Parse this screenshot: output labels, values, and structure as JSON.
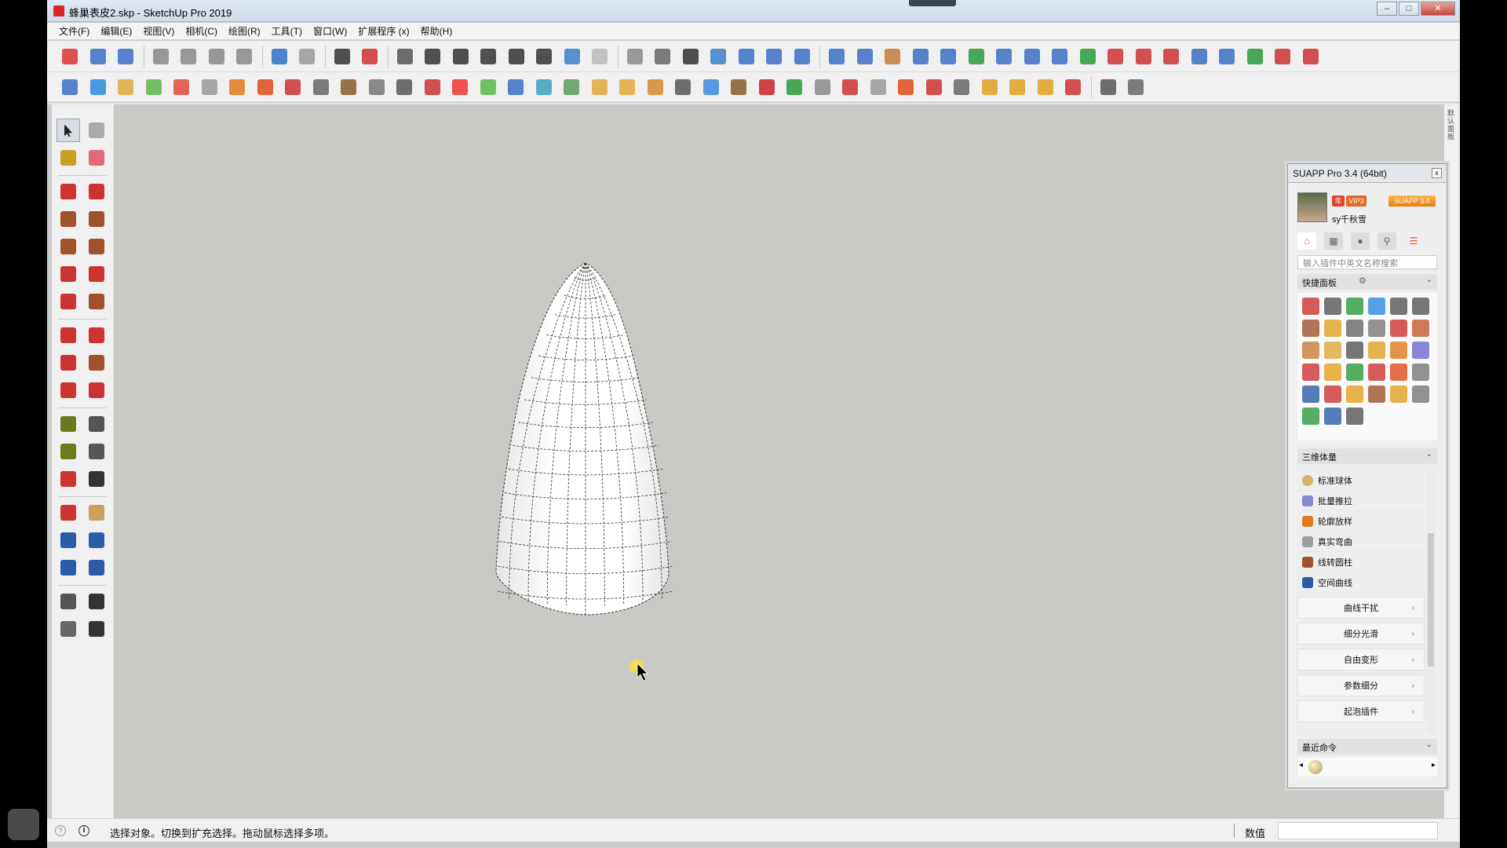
{
  "window": {
    "title": "蜂巢表皮2.skp - SketchUp Pro 2019",
    "controls": {
      "minimize": "–",
      "maximize": "□",
      "close": "✕"
    }
  },
  "menubar": {
    "items": [
      "文件(F)",
      "编辑(E)",
      "视图(V)",
      "相机(C)",
      "绘图(R)",
      "工具(T)",
      "窗口(W)",
      "扩展程序 (x)",
      "帮助(H)"
    ]
  },
  "toolbar1": {
    "icons": [
      "new-file",
      "open-file",
      "save",
      "cut",
      "copy",
      "paste",
      "erase",
      "undo",
      "redo",
      "print",
      "model-info",
      "iso-view",
      "top-view",
      "front-view",
      "right-view",
      "back-view",
      "left-view",
      "xray",
      "wireframe",
      "hidden-line",
      "shaded",
      "shaded-texture",
      "monochrome",
      "section-plane",
      "section-display",
      "section-cut",
      "arc",
      "line",
      "freehand",
      "curve",
      "bezier",
      "arc2",
      "rectangle",
      "circle",
      "arc3",
      "polyline",
      "fillet",
      "round",
      "arc4",
      "spline",
      "polygon",
      "wrench",
      "ellipse",
      "bezier2"
    ],
    "colors": [
      "#d33",
      "#3a6fc4",
      "#3a6fc4",
      "#888",
      "#888",
      "#888",
      "#888",
      "#2f6fc9",
      "#999",
      "#333",
      "#c33",
      "#555",
      "#333",
      "#333",
      "#333",
      "#333",
      "#333",
      "#3a7fc9",
      "#bbb",
      "#888",
      "#666",
      "#333",
      "#3a7fc9",
      "#3a6fc4",
      "#3a6fc4",
      "#3a6fc4",
      "#3a6fc4",
      "#3a6fc4",
      "#c47a3a",
      "#3a6fc4",
      "#3a6fc4",
      "#2a9a3a",
      "#3a6fc4",
      "#3a6fc4",
      "#3a6fc4",
      "#2a9a3a",
      "#c33",
      "#c33",
      "#c33",
      "#3a6fc4",
      "#3a6fc4",
      "#2a9a3a",
      "#c33",
      "#c33"
    ]
  },
  "toolbar2": {
    "icons": [
      "layer1",
      "layer2",
      "layer3",
      "layer4",
      "layer5",
      "layer6",
      "rotate-copy",
      "face-red",
      "grid-lines",
      "frame",
      "box",
      "bridge",
      "corner",
      "dots-curve",
      "cross-red",
      "cross-green",
      "cross-blue",
      "cone",
      "cone2",
      "pyramid",
      "hook",
      "hook2",
      "rotate",
      "move-blue",
      "cube-brown",
      "undo-red",
      "green-shape",
      "move-multi",
      "move-multi2",
      "move-multi3",
      "red-square",
      "shapes",
      "frame-grid",
      "grid-orange",
      "grid-orange2",
      "grid-orange3",
      "x-red",
      "dot-circle",
      "tiles"
    ],
    "colors": [
      "#3a6fc4",
      "#2a8ae0",
      "#e0a83a",
      "#5ab84a",
      "#e04a3a",
      "#999",
      "#e07a1a",
      "#e04a1a",
      "#c33",
      "#666",
      "#8a5a2a",
      "#777",
      "#555",
      "#c33",
      "#e33",
      "#5ab84a",
      "#3a6fc4",
      "#3aa0c4",
      "#5a9a5a",
      "#e0a83a",
      "#e0a83a",
      "#d08a2a",
      "#555",
      "#3a8ae0",
      "#8a5a2a",
      "#c22",
      "#2a9a3a",
      "#888",
      "#c33",
      "#999",
      "#e04a1a",
      "#c33",
      "#666",
      "#e0a020",
      "#e0a020",
      "#e0a020",
      "#c33",
      "#555",
      "#666"
    ]
  },
  "left_toolbar": {
    "tools": [
      [
        "select-tool",
        "component-tool"
      ],
      [
        "paint-bucket-tool",
        "eraser-tool"
      ],
      [
        "line-tool",
        "freehand-tool"
      ],
      [
        "rectangle-tool",
        "rotated-rectangle-tool"
      ],
      [
        "circle-tool",
        "polygon-tool"
      ],
      [
        "arc-tool",
        "two-point-arc-tool"
      ],
      [
        "pie-tool",
        "three-point-arc-tool"
      ],
      [
        "move-tool",
        "push-pull-tool"
      ],
      [
        "rotate-tool",
        "follow-me-tool"
      ],
      [
        "scale-tool",
        "offset-tool"
      ],
      [
        "tape-measure-tool",
        "dimension-tool"
      ],
      [
        "protractor-tool",
        "text-tool"
      ],
      [
        "axes-tool",
        "3d-text-tool"
      ],
      [
        "orbit-tool",
        "pan-tool"
      ],
      [
        "zoom-tool",
        "zoom-window-tool"
      ],
      [
        "zoom-extents-tool",
        "previous-view-tool"
      ],
      [
        "position-camera-tool",
        "look-around-tool"
      ],
      [
        "walk-tool",
        "section-plane-tool"
      ]
    ],
    "colors": [
      [
        "#222",
        "#aaa"
      ],
      [
        "#c9a020",
        "#e06a7a"
      ],
      [
        "#c33",
        "#c33"
      ],
      [
        "#a0522d",
        "#a0522d"
      ],
      [
        "#a0522d",
        "#a0522d"
      ],
      [
        "#c33",
        "#c33"
      ],
      [
        "#c33",
        "#a0522d"
      ],
      [
        "#c33",
        "#c33"
      ],
      [
        "#c33",
        "#a0522d"
      ],
      [
        "#c33",
        "#c33"
      ],
      [
        "#6b7a1a",
        "#555"
      ],
      [
        "#6b7a1a",
        "#555"
      ],
      [
        "#c33",
        "#333"
      ],
      [
        "#c33",
        "#c9a060"
      ],
      [
        "#2a5ca8",
        "#2a5ca8"
      ],
      [
        "#2a5ca8",
        "#2a5ca8"
      ],
      [
        "#555",
        "#333"
      ],
      [
        "#666",
        "#333"
      ]
    ]
  },
  "right_strip": {
    "label": "默认面板"
  },
  "suapp": {
    "title": "SUAPP Pro 3.4 (64bit)",
    "close": "x",
    "badges": {
      "nian": "年",
      "vip": "VIP3",
      "suapp": "SUAPP 3.4"
    },
    "user": "sy千秋雪",
    "search_placeholder": "输入插件中英文名称搜索",
    "quick_panel_label": "快捷面板",
    "quick_colors": [
      "#c33",
      "#555",
      "#2a9a3a",
      "#2a8ae0",
      "#555",
      "#555",
      "#a0522d",
      "#e0a020",
      "#666",
      "#777",
      "#c33",
      "#c35a2a",
      "#c97a3a",
      "#e0a83a",
      "#555",
      "#e0a020",
      "#e07a1a",
      "#6a6ad0",
      "#c33",
      "#e0a020",
      "#2a9a3a",
      "#c33",
      "#e04a1a",
      "#777",
      "#2a5ca8",
      "#c33",
      "#e0a020",
      "#a0522d",
      "#e0a020",
      "#777",
      "#2a9a3a",
      "#2a5ca8",
      "#555"
    ],
    "section_3d_label": "三维体量",
    "items": [
      {
        "label": "标准球体",
        "color": "#d6b26a"
      },
      {
        "label": "批量推拉",
        "color": "#8888cc"
      },
      {
        "label": "轮廓放样",
        "color": "#e07a1a"
      },
      {
        "label": "真实弯曲",
        "color": "#9aa0a6"
      },
      {
        "label": "线转圆柱",
        "color": "#a0522d"
      },
      {
        "label": "空间曲线",
        "color": "#2a5ca8"
      }
    ],
    "groups": [
      "曲线干扰",
      "细分光滑",
      "自由变形",
      "参数细分",
      "起泡插件"
    ],
    "recent_label": "最近命令"
  },
  "statusbar": {
    "text": "选择对象。切换到扩充选择。拖动鼠标选择多项。",
    "value_label": "数值"
  }
}
